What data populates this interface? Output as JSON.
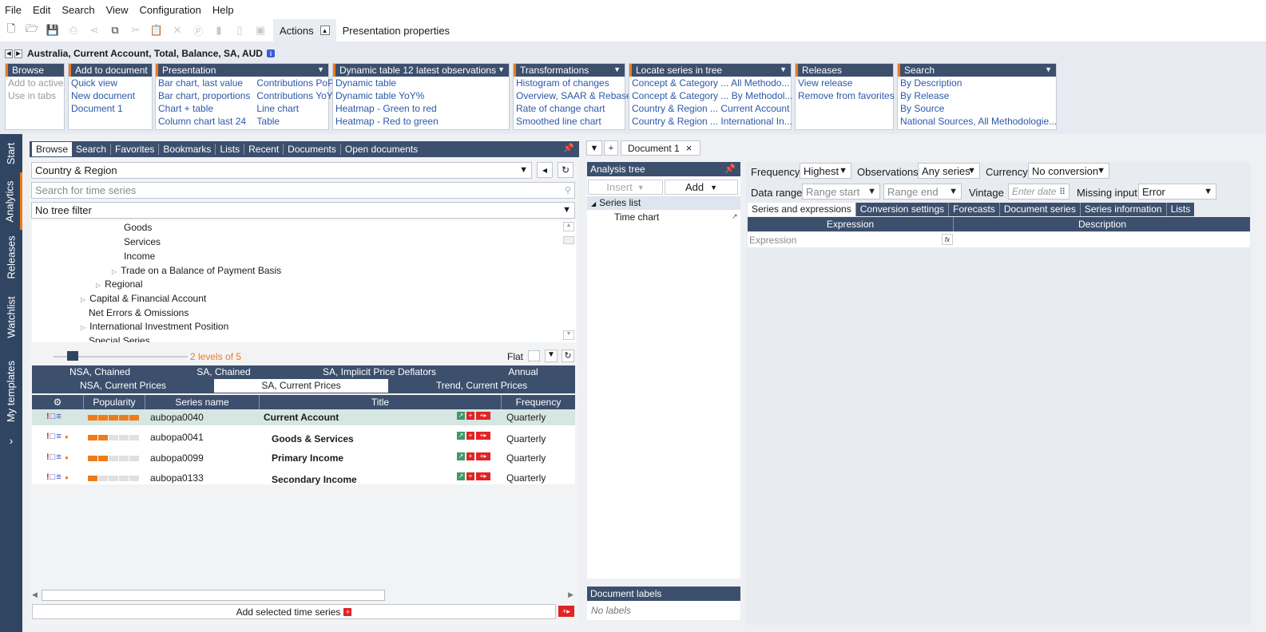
{
  "menu": [
    "File",
    "Edit",
    "Search",
    "View",
    "Configuration",
    "Help"
  ],
  "toolbar": {
    "tabs": [
      "Actions",
      "Presentation properties"
    ]
  },
  "series_title": "Australia, Current Account, Total, Balance, SA, AUD",
  "ribbon": {
    "browse": {
      "title": "Browse",
      "items": [
        "Add to active",
        "Use in tabs"
      ]
    },
    "add_to_document": {
      "title": "Add to document",
      "items": [
        "Quick view",
        "New document",
        "Document 1"
      ]
    },
    "presentation": {
      "title": "Presentation",
      "col1": [
        "Bar chart, last value",
        "Bar chart, proportions",
        "Chart + table",
        "Column chart last 24"
      ],
      "col2": [
        "Contributions PoP",
        "Contributions YoY",
        "Line chart",
        "Table"
      ]
    },
    "dynamic_table": {
      "title": "Dynamic table 12 latest observations",
      "items": [
        "Dynamic table",
        "Dynamic table YoY%",
        "Heatmap - Green to red",
        "Heatmap - Red to green"
      ]
    },
    "transformations": {
      "title": "Transformations",
      "items": [
        "Histogram of changes",
        "Overview, SAAR & Rebase",
        "Rate of change chart",
        "Smoothed line chart"
      ]
    },
    "locate": {
      "title": "Locate series in tree",
      "items": [
        "Concept & Category ... All Methodo...",
        "Concept & Category ... By Methodol...",
        "Country & Region ... Current Account",
        "Country & Region ... International In..."
      ]
    },
    "releases": {
      "title": "Releases",
      "items": [
        "View release",
        "Remove from favorites"
      ]
    },
    "search": {
      "title": "Search",
      "items": [
        "By Description",
        "By Release",
        "By Source",
        "National Sources, All Methodologie..."
      ]
    }
  },
  "sidebar": [
    "Start",
    "Analytics",
    "Releases",
    "Watchlist",
    "My templates"
  ],
  "left": {
    "tabs": [
      "Browse",
      "Search",
      "Favorites",
      "Bookmarks",
      "Lists",
      "Recent",
      "Documents",
      "Open documents"
    ],
    "tree_root": "Country & Region",
    "search_placeholder": "Search for time series",
    "tree_filter": "No tree filter",
    "tree_items": [
      {
        "label": "Goods",
        "indent": 3,
        "expander": false
      },
      {
        "label": "Services",
        "indent": 3,
        "expander": false
      },
      {
        "label": "Income",
        "indent": 3,
        "expander": false
      },
      {
        "label": "Trade on a Balance of Payment Basis",
        "indent": 3,
        "expander": true
      },
      {
        "label": "Regional",
        "indent": 2,
        "expander": true
      },
      {
        "label": "Capital & Financial Account",
        "indent": 1,
        "expander": true
      },
      {
        "label": "Net Errors & Omissions",
        "indent": 1,
        "expander": false
      },
      {
        "label": "International Investment Position",
        "indent": 1,
        "expander": true
      },
      {
        "label": "Special Series",
        "indent": 1,
        "expander": false
      }
    ],
    "levels": "2 levels of 5",
    "flat_label": "Flat",
    "filter_tabs_row1": [
      "NSA, Chained",
      "SA, Chained",
      "SA, Implicit Price Deflators",
      "Annual"
    ],
    "filter_tabs_row2": [
      "NSA, Current Prices",
      "SA, Current Prices",
      "Trend, Current Prices"
    ],
    "grid_columns": [
      "Popularity",
      "Series name",
      "Title",
      "Frequency"
    ],
    "grid_rows": [
      {
        "name": "aubopa0040",
        "title": "Current Account",
        "frequency": "Quarterly",
        "popularity": 5
      },
      {
        "name": "aubopa0041",
        "title": "Goods & Services",
        "frequency": "Quarterly",
        "popularity": 2
      },
      {
        "name": "aubopa0099",
        "title": "Primary Income",
        "frequency": "Quarterly",
        "popularity": 2
      },
      {
        "name": "aubopa0133",
        "title": "Secondary Income",
        "frequency": "Quarterly",
        "popularity": 1
      }
    ],
    "add_selected": "Add selected time series"
  },
  "document": {
    "tab": "Document 1",
    "analysis_tree": "Analysis tree",
    "insert": "Insert",
    "add": "Add",
    "series_list": "Series list",
    "time_chart": "Time chart",
    "doc_labels": "Document labels",
    "no_labels": "No labels"
  },
  "right": {
    "frequency_label": "Frequency",
    "frequency": "Highest",
    "observations_label": "Observations",
    "observations": "Any series",
    "currency_label": "Currency",
    "currency": "No conversion",
    "data_range_label": "Data range",
    "range_start": "Range start",
    "range_end": "Range end",
    "vintage_label": "Vintage",
    "vintage_placeholder": "Enter date",
    "missing_label": "Missing input",
    "missing": "Error",
    "subtabs": [
      "Series and expressions",
      "Conversion settings",
      "Forecasts",
      "Document series",
      "Series information",
      "Lists"
    ],
    "col_expression": "Expression",
    "col_description": "Description",
    "expression_placeholder": "Expression",
    "fx": "fx"
  }
}
